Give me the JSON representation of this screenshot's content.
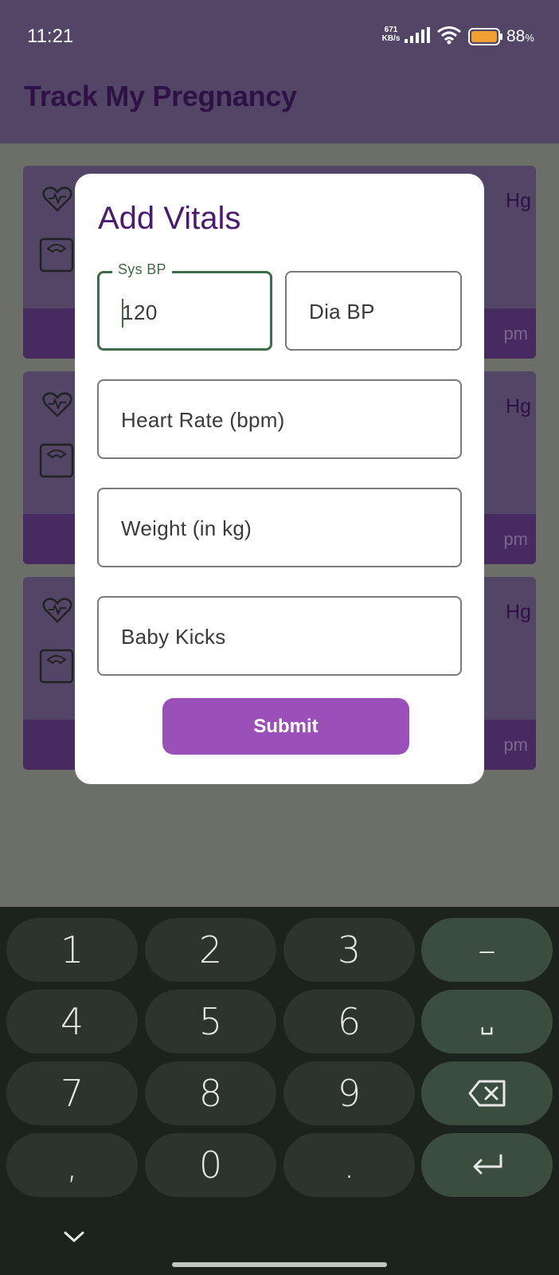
{
  "status_bar": {
    "time": "11:21",
    "net_speed_value": "671",
    "net_speed_unit": "KB/s",
    "battery_value": "88",
    "battery_unit": "%"
  },
  "app_bar": {
    "title": "Track My Pregnancy"
  },
  "vitals_cards": [
    {
      "bp_unit": "Hg",
      "time_suffix": "pm"
    },
    {
      "bp_unit": "Hg",
      "time_suffix": "pm"
    },
    {
      "bp_unit": "Hg",
      "time_suffix": "pm"
    }
  ],
  "dialog": {
    "title": "Add Vitals",
    "sys_bp": {
      "label": "Sys BP",
      "value": "120"
    },
    "dia_bp": {
      "placeholder": "Dia BP"
    },
    "heart_rate": {
      "placeholder": "Heart Rate (bpm)"
    },
    "weight": {
      "placeholder": "Weight (in kg)"
    },
    "baby_kicks": {
      "placeholder": "Baby Kicks"
    },
    "submit_label": "Submit"
  },
  "keyboard": {
    "keys": [
      "1",
      "2",
      "3",
      "–",
      "4",
      "5",
      "6",
      "␣",
      "7",
      "8",
      "9",
      "⌫",
      ",",
      "0",
      ".",
      "↵"
    ],
    "icons": {
      "minus": "minus-key",
      "space": "space-key",
      "backspace": "backspace-icon",
      "enter": "enter-icon",
      "collapse": "chevron-down-icon"
    }
  },
  "colors": {
    "app_bar": "#524566",
    "title_text": "#4a1a72",
    "focused_border": "#3f6b4a",
    "submit_button": "#9b50b9",
    "keyboard_bg": "#1c231d",
    "key_bg": "#2d342e",
    "action_key_bg": "#3a4d3e"
  }
}
